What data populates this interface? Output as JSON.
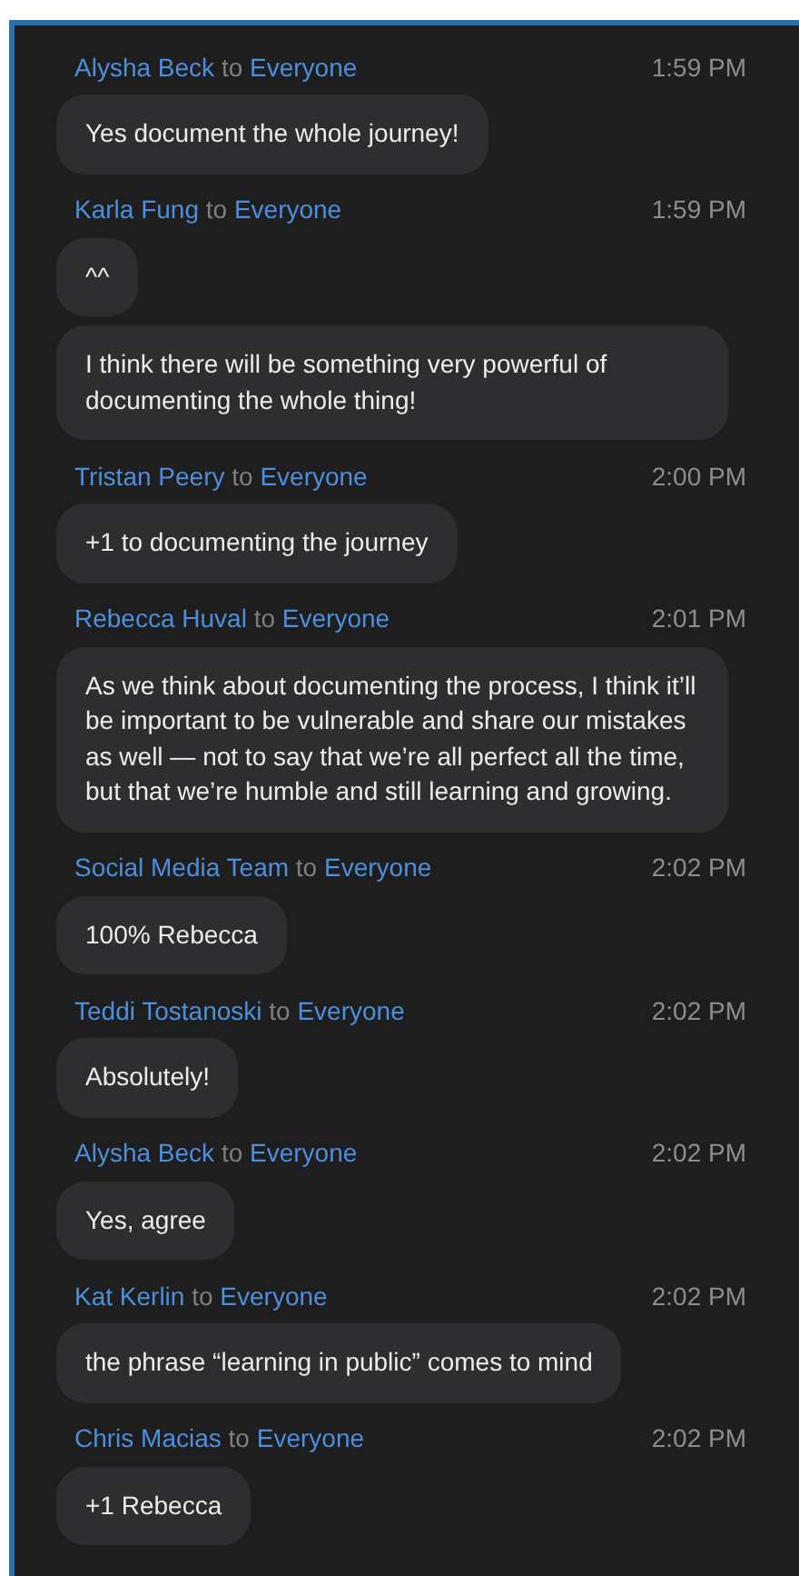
{
  "messages": [
    {
      "sender": "Alysha Beck",
      "connector": "to",
      "recipient": "Everyone",
      "time": "1:59 PM",
      "bubbles": [
        "Yes document the whole journey!"
      ]
    },
    {
      "sender": "Karla Fung",
      "connector": "to",
      "recipient": "Everyone",
      "time": "1:59 PM",
      "bubbles": [
        "^^",
        "I think there will be something very powerful of documenting the whole thing!"
      ]
    },
    {
      "sender": "Tristan Peery",
      "connector": "to",
      "recipient": "Everyone",
      "time": "2:00 PM",
      "bubbles": [
        "+1 to documenting the journey"
      ]
    },
    {
      "sender": "Rebecca Huval",
      "connector": "to",
      "recipient": "Everyone",
      "time": "2:01 PM",
      "bubbles": [
        "As we think about documenting the process, I think it’ll be important to be vulnerable and share our mistakes as well — not to say that we’re all perfect all the time, but that we’re humble and still learning and growing."
      ]
    },
    {
      "sender": "Social Media Team",
      "connector": "to",
      "recipient": "Everyone",
      "time": "2:02 PM",
      "bubbles": [
        "100% Rebecca"
      ]
    },
    {
      "sender": "Teddi Tostanoski",
      "connector": "to",
      "recipient": "Everyone",
      "time": "2:02 PM",
      "bubbles": [
        "Absolutely!"
      ]
    },
    {
      "sender": "Alysha Beck",
      "connector": "to",
      "recipient": "Everyone",
      "time": "2:02 PM",
      "bubbles": [
        "Yes, agree"
      ]
    },
    {
      "sender": "Kat Kerlin",
      "connector": "to",
      "recipient": "Everyone",
      "time": "2:02 PM",
      "bubbles": [
        "the phrase “learning in public” comes to mind"
      ]
    },
    {
      "sender": "Chris Macias",
      "connector": "to",
      "recipient": "Everyone",
      "time": "2:02 PM",
      "bubbles": [
        "+1 Rebecca"
      ]
    }
  ]
}
